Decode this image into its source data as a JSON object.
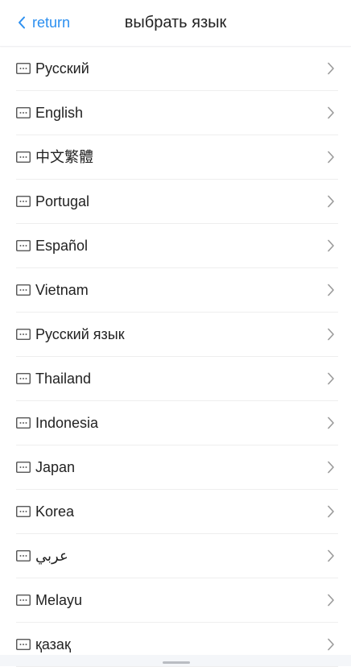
{
  "header": {
    "back_label": "return",
    "title": "выбрать язык",
    "back_icon": "chevron-left-icon"
  },
  "accent_color": "#2b8ff0",
  "languages": [
    {
      "label": "Русский"
    },
    {
      "label": "English"
    },
    {
      "label": "中文繁體"
    },
    {
      "label": "Portugal"
    },
    {
      "label": "Español"
    },
    {
      "label": "Vietnam"
    },
    {
      "label": "Русский язык"
    },
    {
      "label": "Thailand"
    },
    {
      "label": "Indonesia"
    },
    {
      "label": "Japan"
    },
    {
      "label": "Korea"
    },
    {
      "label": "عربي"
    },
    {
      "label": "Melayu"
    },
    {
      "label": "қазақ"
    }
  ],
  "item_icon": "keyboard-icon",
  "item_chevron_icon": "chevron-right-icon"
}
